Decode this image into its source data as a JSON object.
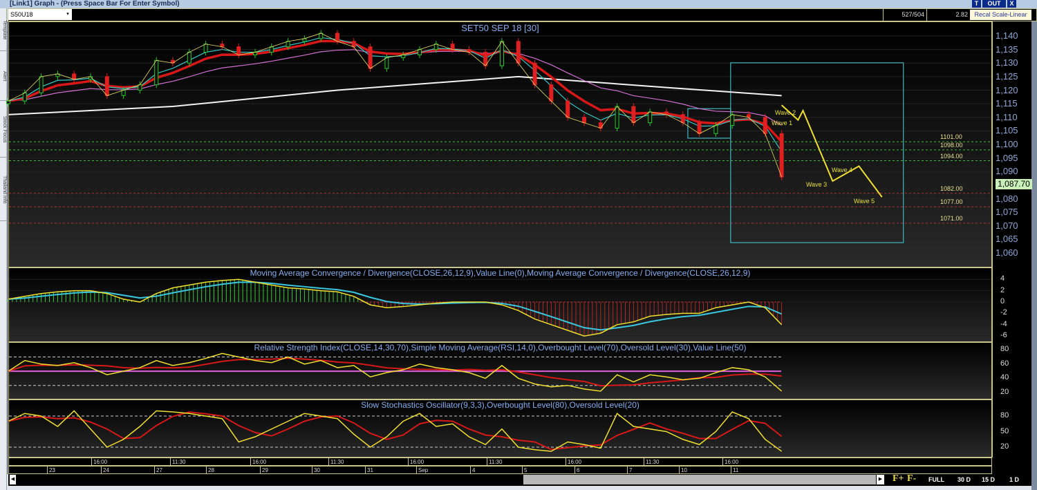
{
  "window": {
    "title": "[Link1] Graph  - (Press Space Bar For Enter Symbol)",
    "buttons": [
      "T",
      "OUT",
      "X"
    ]
  },
  "sidebar": {
    "tabs": [
      "Template",
      "Alert",
      "Stock Focus",
      "Thailand Info"
    ]
  },
  "toolbar": {
    "symbol": "S50U18",
    "counter": "527/504",
    "value": "2.82",
    "recal_label": "Recal Scale-Linear"
  },
  "main": {
    "title": "SET50 SEP 18   [30]",
    "last_price": "1,087.70",
    "price_ticks": [
      "1,140",
      "1,135",
      "1,130",
      "1,125",
      "1,120",
      "1,115",
      "1,110",
      "1,105",
      "1,100",
      "1,095",
      "1,090",
      "1,080",
      "1,075",
      "1,070",
      "1,065",
      "1,060"
    ],
    "levels": [
      {
        "label": "1101.00",
        "value": 1101,
        "color": "#3fbf3f"
      },
      {
        "label": "1098.00",
        "value": 1098,
        "color": "#3fbf3f"
      },
      {
        "label": "1094.00",
        "value": 1094,
        "color": "#3fbf3f"
      },
      {
        "label": "1082.00",
        "value": 1082,
        "color": "#b03030"
      },
      {
        "label": "1077.00",
        "value": 1077,
        "color": "#b03030"
      },
      {
        "label": "1071.00",
        "value": 1071,
        "color": "#b03030"
      }
    ],
    "waves": [
      "Wave 1",
      "Wave 2",
      "Wave 3",
      "Wave 4",
      "Wave 5"
    ]
  },
  "macd": {
    "title": "Moving Average Convergence / Divergence(CLOSE,26,12,9),Value Line(0),Moving Average Convergence / Divergence(CLOSE,26,12,9)",
    "ticks": [
      "4",
      "2",
      "0",
      "-2",
      "-4",
      "-6"
    ]
  },
  "rsi": {
    "title": "Relative Strength Index(CLOSE,14,30,70),Simple Moving Average(RSI,14,0),Overbought Level(70),Oversold Level(30),Value Line(50)",
    "ticks": [
      "80",
      "60",
      "40",
      "20"
    ]
  },
  "stoch": {
    "title": "Slow Stochastics Oscillator(9,3,3),Overbought Level(80),Oversold Level(20)",
    "ticks": [
      "80",
      "50",
      "20"
    ]
  },
  "time_axis": {
    "times": [
      "16:00",
      "11:30",
      "16:00",
      "11:30",
      "16:00",
      "11:30",
      "16:00",
      "11:30",
      "16:00"
    ],
    "dates": [
      "23",
      "24",
      "27",
      "28",
      "29",
      "30",
      "31",
      "Sep",
      "4",
      "5",
      "6",
      "7",
      "10",
      "11"
    ]
  },
  "footer": {
    "f_plus": "F+",
    "f_minus": "F-",
    "ranges": [
      "FULL",
      "30 D",
      "15 D",
      "1 D"
    ]
  },
  "chart_data": {
    "type": "line",
    "title": "SET50 SEP 18 [30]",
    "ylim": [
      1058,
      1142
    ],
    "close": [
      1116,
      1119,
      1125,
      1126,
      1124,
      1125,
      1118,
      1120,
      1122,
      1131,
      1130,
      1134,
      1137,
      1136,
      1133,
      1134,
      1136,
      1138,
      1139,
      1141,
      1138,
      1136,
      1128,
      1132,
      1133,
      1135,
      1137,
      1135,
      1134,
      1129,
      1138,
      1130,
      1122,
      1116,
      1110,
      1108,
      1106,
      1114,
      1108,
      1112,
      1111,
      1108,
      1104,
      1107,
      1111,
      1110,
      1104,
      1088
    ],
    "ma_long": [
      [
        0,
        1111
      ],
      [
        10,
        1114
      ],
      [
        20,
        1120
      ],
      [
        31,
        1125
      ],
      [
        40,
        1121
      ],
      [
        47,
        1118
      ]
    ],
    "wave_projection": [
      [
        47,
        1114.5
      ],
      [
        48,
        1109
      ],
      [
        48.3,
        1112.5
      ],
      [
        50.1,
        1086.5
      ],
      [
        51.7,
        1092
      ],
      [
        53.1,
        1080.6
      ]
    ],
    "boxes": [
      {
        "from": 43.9,
        "to": 54.4,
        "high": 1130.1,
        "low": 1063.8
      },
      {
        "from": 41.3,
        "to": 43.9,
        "high": 1113.2,
        "low": 1102.3
      }
    ],
    "macd": [
      0.5,
      1,
      1.5,
      1.8,
      2,
      2,
      1.5,
      0.5,
      0,
      1.5,
      2.5,
      3,
      3.5,
      3.8,
      4,
      3.5,
      3,
      2.5,
      2.3,
      2,
      1.8,
      1,
      -0.5,
      -1,
      -0.8,
      -0.5,
      -0.2,
      0,
      0,
      0,
      -0.5,
      -1.5,
      -3,
      -4,
      -5,
      -6,
      -5.5,
      -4,
      -3.5,
      -2.5,
      -2.2,
      -2,
      -2,
      -1,
      -0.5,
      0,
      -1,
      -4
    ],
    "macd_ylim": [
      -7,
      5.5
    ],
    "rsi": [
      50,
      65,
      60,
      58,
      62,
      55,
      45,
      50,
      55,
      65,
      58,
      62,
      68,
      75,
      70,
      65,
      62,
      70,
      60,
      65,
      55,
      58,
      42,
      48,
      52,
      60,
      55,
      52,
      48,
      40,
      58,
      40,
      32,
      28,
      30,
      25,
      22,
      45,
      35,
      45,
      42,
      38,
      40,
      48,
      55,
      52,
      42,
      22
    ],
    "stoch": [
      70,
      85,
      80,
      60,
      90,
      55,
      20,
      35,
      60,
      90,
      88,
      85,
      80,
      75,
      30,
      40,
      55,
      70,
      85,
      80,
      75,
      45,
      20,
      40,
      70,
      85,
      60,
      65,
      40,
      25,
      55,
      20,
      15,
      12,
      30,
      25,
      18,
      85,
      60,
      55,
      50,
      35,
      25,
      50,
      88,
      75,
      35,
      12
    ]
  }
}
